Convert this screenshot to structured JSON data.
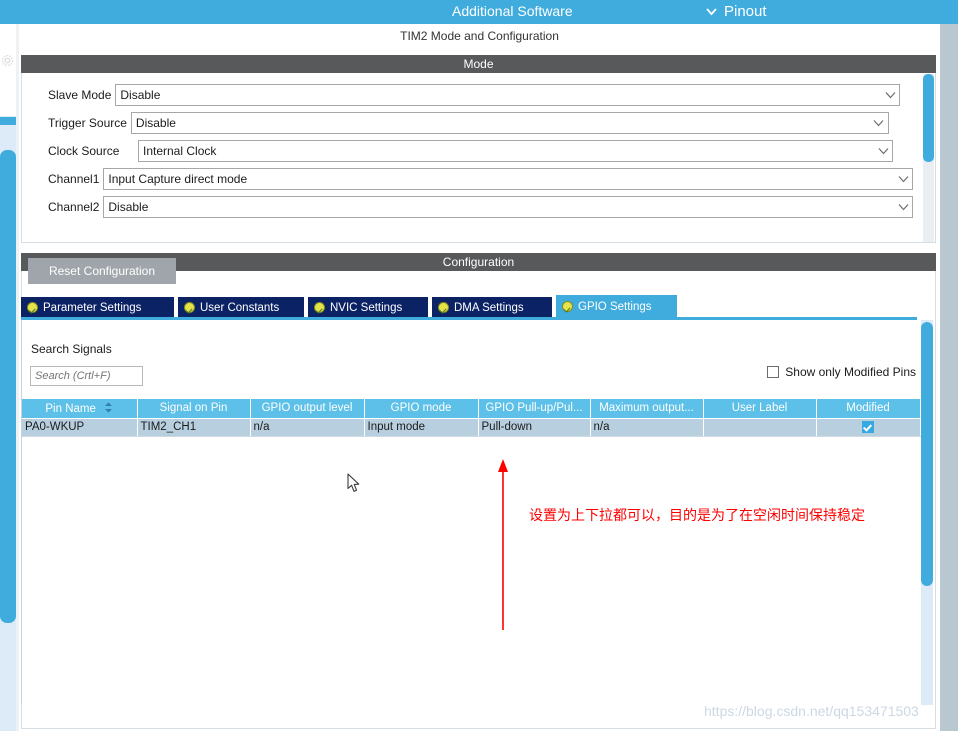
{
  "topbar": {
    "additional_software": "Additional Software",
    "pinout": "Pinout",
    "chevron_icon": "chevron-down-icon",
    "bg_color": "#40ACDE"
  },
  "page": {
    "title": "TIM2 Mode and Configuration"
  },
  "mode": {
    "header": "Mode",
    "rows": [
      {
        "label": "Slave Mode",
        "value": "Disable"
      },
      {
        "label": "Trigger Source",
        "value": "Disable"
      },
      {
        "label": "Clock Source",
        "value": "Internal Clock"
      },
      {
        "label": "Channel1",
        "value": "Input Capture direct mode"
      },
      {
        "label": "Channel2",
        "value": "Disable"
      }
    ]
  },
  "configuration": {
    "header": "Configuration",
    "reset_button": "Reset Configuration",
    "tabs": [
      {
        "label": "Parameter Settings",
        "active": false
      },
      {
        "label": "User Constants",
        "active": false
      },
      {
        "label": "NVIC Settings",
        "active": false
      },
      {
        "label": "DMA Settings",
        "active": false
      },
      {
        "label": "GPIO Settings",
        "active": true
      }
    ]
  },
  "gpio": {
    "search_label": "Search Signals",
    "search_value": "",
    "search_placeholder": "Search (Crtl+F)",
    "show_only_modified": "Show only Modified Pins",
    "show_only_modified_checked": false,
    "columns": [
      "Pin Name",
      "Signal on Pin",
      "GPIO output level",
      "GPIO mode",
      "GPIO Pull-up/Pul...",
      "Maximum output...",
      "User Label",
      "Modified"
    ],
    "rows": [
      {
        "pin_name": "PA0-WKUP",
        "signal_on_pin": "TIM2_CH1",
        "gpio_output_level": "n/a",
        "gpio_mode": "Input mode",
        "gpio_pull": "Pull-down",
        "max_output": "n/a",
        "user_label": "",
        "modified": true
      }
    ]
  },
  "annotation": {
    "text": "设置为上下拉都可以，目的是为了在空闲时间保持稳定",
    "color": "#FF0000"
  },
  "watermark": {
    "text": "https://blog.csdn.net/qq153471503"
  }
}
